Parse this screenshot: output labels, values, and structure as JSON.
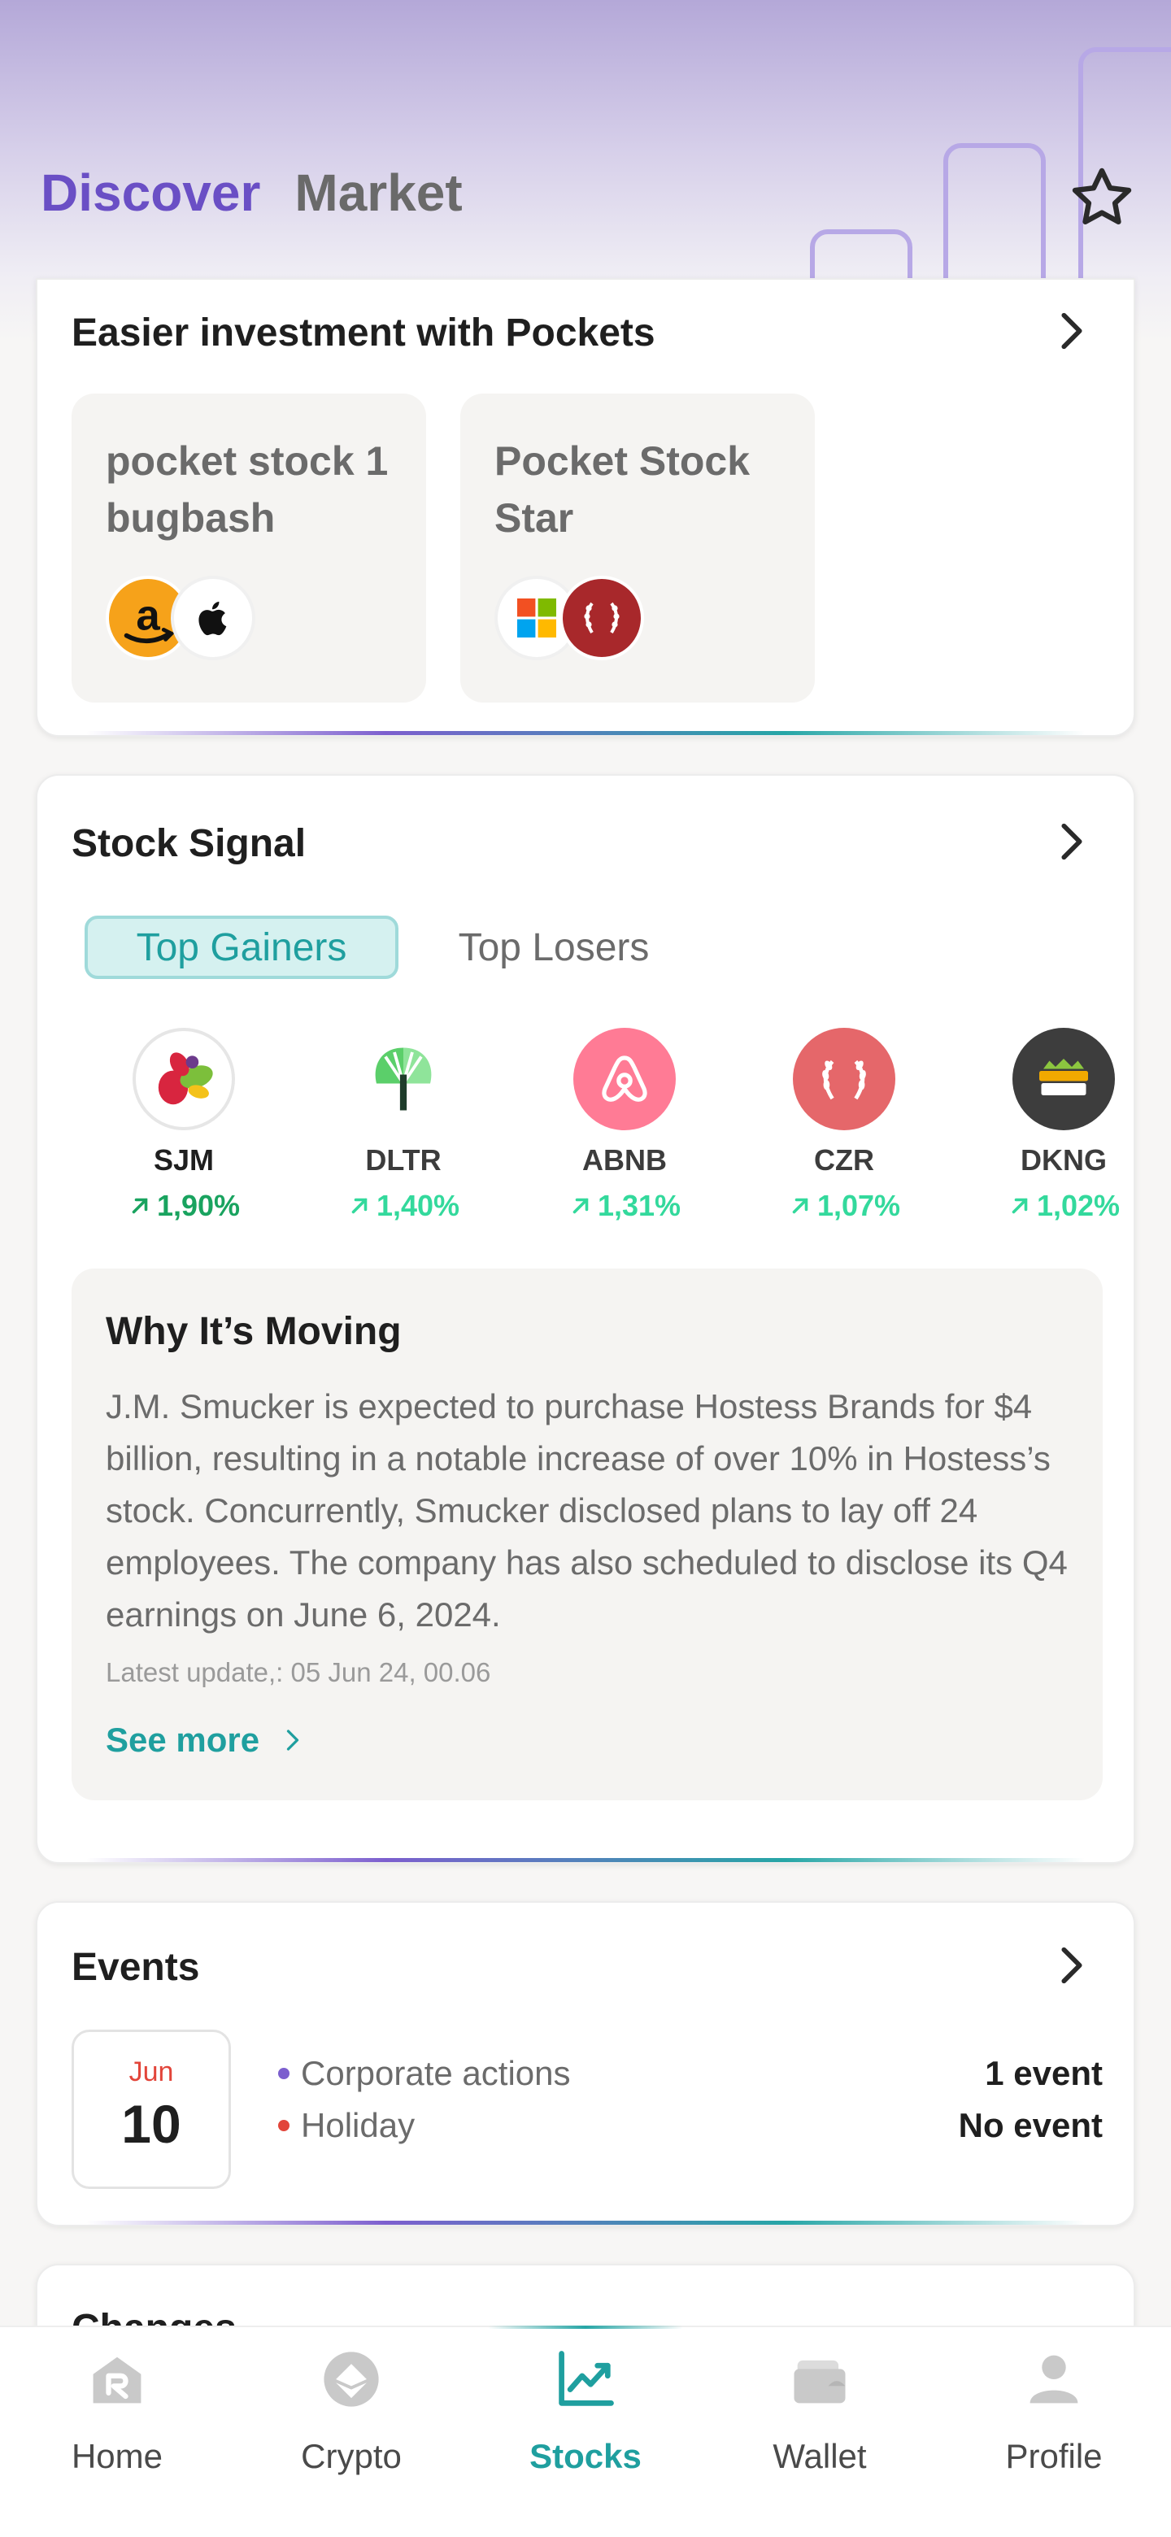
{
  "header": {
    "tabs": [
      {
        "label": "Discover",
        "active": true
      },
      {
        "label": "Market",
        "active": false
      }
    ]
  },
  "pockets": {
    "title": "Easier investment with Pockets",
    "items": [
      {
        "name": "pocket stock 1 bugbash",
        "logos": [
          "amazon-logo",
          "apple-logo"
        ]
      },
      {
        "name": "Pocket Stock Star",
        "logos": [
          "microsoft-logo",
          "laurel-logo"
        ]
      }
    ]
  },
  "signal": {
    "title": "Stock Signal",
    "tabs": [
      {
        "label": "Top Gainers",
        "active": true
      },
      {
        "label": "Top Losers",
        "active": false
      }
    ],
    "movers": [
      {
        "symbol": "SJM",
        "change": "1,90%",
        "logo": "smucker-logo"
      },
      {
        "symbol": "DLTR",
        "change": "1,40%",
        "logo": "dollar-tree-logo"
      },
      {
        "symbol": "ABNB",
        "change": "1,31%",
        "logo": "airbnb-logo"
      },
      {
        "symbol": "CZR",
        "change": "1,07%",
        "logo": "caesars-logo"
      },
      {
        "symbol": "DKNG",
        "change": "1,02%",
        "logo": "draftkings-logo"
      }
    ],
    "why": {
      "title": "Why It’s Moving",
      "body": "J.M. Smucker is expected to purchase Hostess Brands for $4 billion, resulting in a notable increase of over 10% in Hostess’s stock. Concurrently, Smucker disclosed plans to lay off 24 employees. The company has also scheduled to disclose its Q4 earnings on June 6, 2024.",
      "updated": "Latest update,: 05 Jun 24, 00.06",
      "see_more": "See more"
    }
  },
  "events": {
    "title": "Events",
    "month": "Jun",
    "day": "10",
    "rows": [
      {
        "label": "Corporate actions",
        "count": "1 event",
        "dot_color": "#7c5fce"
      },
      {
        "label": "Holiday",
        "count": "No event",
        "dot_color": "#e2453a"
      }
    ]
  },
  "changes": {
    "title": "Changes"
  },
  "bottom_nav": [
    {
      "label": "Home",
      "icon": "home-icon",
      "active": false
    },
    {
      "label": "Crypto",
      "icon": "crypto-icon",
      "active": false
    },
    {
      "label": "Stocks",
      "icon": "stocks-chart-icon",
      "active": true
    },
    {
      "label": "Wallet",
      "icon": "wallet-icon",
      "active": false
    },
    {
      "label": "Profile",
      "icon": "profile-icon",
      "active": false
    }
  ],
  "colors": {
    "brand_purple": "#6a4fc5",
    "accent_teal": "#1f9f9f",
    "gain_green": "#33d99c",
    "holiday_red": "#e2453a"
  }
}
